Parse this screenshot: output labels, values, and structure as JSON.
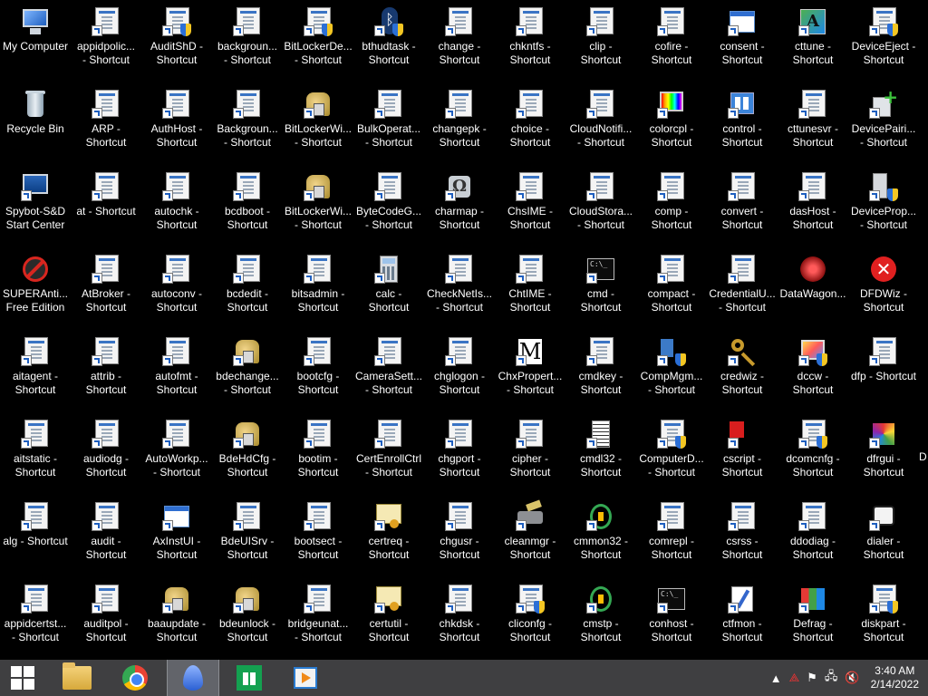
{
  "desktop": {
    "icons": [
      {
        "label": "My Computer",
        "icon": "my-computer-icon",
        "type": "computer"
      },
      {
        "label": "Recycle Bin",
        "icon": "recycle-bin-icon",
        "type": "bin"
      },
      {
        "label": "Spybot-S&D\nStart Center",
        "icon": "spybot-icon",
        "type": "spybot"
      },
      {
        "label": "SUPERAnti...\nFree Edition",
        "icon": "superantispyware-icon",
        "type": "super"
      },
      {
        "label": "aitagent -\nShortcut",
        "icon": "shortcut-icon",
        "type": "file"
      },
      {
        "label": "aitstatic -\nShortcut",
        "icon": "shortcut-icon",
        "type": "file"
      },
      {
        "label": "alg - Shortcut",
        "icon": "shortcut-icon",
        "type": "file"
      },
      {
        "label": "appidcertst...\n- Shortcut",
        "icon": "shortcut-icon",
        "type": "file"
      },
      {
        "label": "appidpolic...\n- Shortcut",
        "icon": "shortcut-icon",
        "type": "file"
      },
      {
        "label": "ARP -\nShortcut",
        "icon": "shortcut-icon",
        "type": "file"
      },
      {
        "label": "at - Shortcut",
        "icon": "shortcut-icon",
        "type": "file"
      },
      {
        "label": "AtBroker -\nShortcut",
        "icon": "shortcut-icon",
        "type": "file"
      },
      {
        "label": "attrib -\nShortcut",
        "icon": "shortcut-icon",
        "type": "file"
      },
      {
        "label": "audiodg -\nShortcut",
        "icon": "shortcut-icon",
        "type": "file"
      },
      {
        "label": "audit -\nShortcut",
        "icon": "shortcut-icon",
        "type": "file"
      },
      {
        "label": "auditpol -\nShortcut",
        "icon": "shortcut-icon",
        "type": "file"
      },
      {
        "label": "AuditShD -\nShortcut",
        "icon": "shield-shortcut-icon",
        "type": "shield"
      },
      {
        "label": "AuthHost -\nShortcut",
        "icon": "shortcut-icon",
        "type": "file"
      },
      {
        "label": "autochk -\nShortcut",
        "icon": "shortcut-icon",
        "type": "file"
      },
      {
        "label": "autoconv -\nShortcut",
        "icon": "shortcut-icon",
        "type": "file"
      },
      {
        "label": "autofmt -\nShortcut",
        "icon": "shortcut-icon",
        "type": "file"
      },
      {
        "label": "AutoWorkp...\n- Shortcut",
        "icon": "shortcut-icon",
        "type": "file"
      },
      {
        "label": "AxInstUI -\nShortcut",
        "icon": "window-shortcut-icon",
        "type": "window"
      },
      {
        "label": "baaupdate -\nShortcut",
        "icon": "keys-shortcut-icon",
        "type": "keys"
      },
      {
        "label": "backgroun...\n- Shortcut",
        "icon": "shortcut-icon",
        "type": "file"
      },
      {
        "label": "Backgroun...\n- Shortcut",
        "icon": "shortcut-icon",
        "type": "file"
      },
      {
        "label": "bcdboot -\nShortcut",
        "icon": "shortcut-icon",
        "type": "file"
      },
      {
        "label": "bcdedit -\nShortcut",
        "icon": "shortcut-icon",
        "type": "file"
      },
      {
        "label": "bdechange...\n- Shortcut",
        "icon": "keys-shortcut-icon",
        "type": "keys"
      },
      {
        "label": "BdeHdCfg -\nShortcut",
        "icon": "keys-shortcut-icon",
        "type": "keys"
      },
      {
        "label": "BdeUISrv -\nShortcut",
        "icon": "shortcut-icon",
        "type": "file"
      },
      {
        "label": "bdeunlock -\nShortcut",
        "icon": "keys-shortcut-icon",
        "type": "keys"
      },
      {
        "label": "BitLockerDe...\n- Shortcut",
        "icon": "shield-shortcut-icon",
        "type": "shield"
      },
      {
        "label": "BitLockerWi...\n- Shortcut",
        "icon": "keys-shortcut-icon",
        "type": "keys"
      },
      {
        "label": "BitLockerWi...\n- Shortcut",
        "icon": "keys-shortcut-icon",
        "type": "keys"
      },
      {
        "label": "bitsadmin -\nShortcut",
        "icon": "shortcut-icon",
        "type": "file"
      },
      {
        "label": "bootcfg -\nShortcut",
        "icon": "shortcut-icon",
        "type": "file"
      },
      {
        "label": "bootim -\nShortcut",
        "icon": "shortcut-icon",
        "type": "file"
      },
      {
        "label": "bootsect -\nShortcut",
        "icon": "shortcut-icon",
        "type": "file"
      },
      {
        "label": "bridgeunat...\n- Shortcut",
        "icon": "shortcut-icon",
        "type": "file"
      },
      {
        "label": "bthudtask -\nShortcut",
        "icon": "bluetooth-shortcut-icon",
        "type": "bt"
      },
      {
        "label": "BulkOperat...\n- Shortcut",
        "icon": "shortcut-icon",
        "type": "file"
      },
      {
        "label": "ByteCodeG...\n- Shortcut",
        "icon": "shortcut-icon",
        "type": "file"
      },
      {
        "label": "calc -\nShortcut",
        "icon": "calculator-shortcut-icon",
        "type": "calc"
      },
      {
        "label": "CameraSett...\n- Shortcut",
        "icon": "shortcut-icon",
        "type": "file"
      },
      {
        "label": "CertEnrollCtrl\n- Shortcut",
        "icon": "shortcut-icon",
        "type": "file"
      },
      {
        "label": "certreq -\nShortcut",
        "icon": "certificate-shortcut-icon",
        "type": "cert"
      },
      {
        "label": "certutil -\nShortcut",
        "icon": "certificate-shortcut-icon",
        "type": "cert"
      },
      {
        "label": "change -\nShortcut",
        "icon": "shortcut-icon",
        "type": "file"
      },
      {
        "label": "changepk -\nShortcut",
        "icon": "shortcut-icon",
        "type": "file"
      },
      {
        "label": "charmap -\nShortcut",
        "icon": "charmap-shortcut-icon",
        "type": "charmap"
      },
      {
        "label": "CheckNetIs...\n- Shortcut",
        "icon": "shortcut-icon",
        "type": "file"
      },
      {
        "label": "chglogon -\nShortcut",
        "icon": "shortcut-icon",
        "type": "file"
      },
      {
        "label": "chgport -\nShortcut",
        "icon": "shortcut-icon",
        "type": "file"
      },
      {
        "label": "chgusr -\nShortcut",
        "icon": "shortcut-icon",
        "type": "file"
      },
      {
        "label": "chkdsk -\nShortcut",
        "icon": "shortcut-icon",
        "type": "file"
      },
      {
        "label": "chkntfs -\nShortcut",
        "icon": "shortcut-icon",
        "type": "file"
      },
      {
        "label": "choice -\nShortcut",
        "icon": "shortcut-icon",
        "type": "file"
      },
      {
        "label": "ChsIME -\nShortcut",
        "icon": "shortcut-icon",
        "type": "file"
      },
      {
        "label": "ChtIME -\nShortcut",
        "icon": "shortcut-icon",
        "type": "file"
      },
      {
        "label": "ChxPropert...\n- Shortcut",
        "icon": "chx-shortcut-icon",
        "type": "chx"
      },
      {
        "label": "cipher -\nShortcut",
        "icon": "shortcut-icon",
        "type": "file"
      },
      {
        "label": "cleanmgr -\nShortcut",
        "icon": "cleanmgr-shortcut-icon",
        "type": "cleanmgr"
      },
      {
        "label": "cliconfg -\nShortcut",
        "icon": "shield-shortcut-icon",
        "type": "shield"
      },
      {
        "label": "clip -\nShortcut",
        "icon": "shortcut-icon",
        "type": "file"
      },
      {
        "label": "CloudNotifi...\n- Shortcut",
        "icon": "shortcut-icon",
        "type": "file"
      },
      {
        "label": "CloudStora...\n- Shortcut",
        "icon": "shortcut-icon",
        "type": "file"
      },
      {
        "label": "cmd -\nShortcut",
        "icon": "cmd-shortcut-icon",
        "type": "cmd"
      },
      {
        "label": "cmdkey -\nShortcut",
        "icon": "shortcut-icon",
        "type": "file"
      },
      {
        "label": "cmdl32 -\nShortcut",
        "icon": "cmdl32-shortcut-icon",
        "type": "cmdl"
      },
      {
        "label": "cmmon32 -\nShortcut",
        "icon": "cmmon32-shortcut-icon",
        "type": "cmmon"
      },
      {
        "label": "cmstp -\nShortcut",
        "icon": "cmstp-shortcut-icon",
        "type": "cmmon"
      },
      {
        "label": "cofire -\nShortcut",
        "icon": "shortcut-icon",
        "type": "file"
      },
      {
        "label": "colorcpl -\nShortcut",
        "icon": "colorcpl-shortcut-icon",
        "type": "colorcpl"
      },
      {
        "label": "comp -\nShortcut",
        "icon": "shortcut-icon",
        "type": "file"
      },
      {
        "label": "compact -\nShortcut",
        "icon": "shortcut-icon",
        "type": "file"
      },
      {
        "label": "CompMgm...\n- Shortcut",
        "icon": "compmgmt-shortcut-icon",
        "type": "compmgmt"
      },
      {
        "label": "ComputerD...\n- Shortcut",
        "icon": "shield-shortcut-icon",
        "type": "shield"
      },
      {
        "label": "comrepl -\nShortcut",
        "icon": "shortcut-icon",
        "type": "file"
      },
      {
        "label": "conhost -\nShortcut",
        "icon": "cmd-shortcut-icon",
        "type": "cmd"
      },
      {
        "label": "consent -\nShortcut",
        "icon": "window-shortcut-icon",
        "type": "window"
      },
      {
        "label": "control -\nShortcut",
        "icon": "control-panel-shortcut-icon",
        "type": "control"
      },
      {
        "label": "convert -\nShortcut",
        "icon": "shortcut-icon",
        "type": "file"
      },
      {
        "label": "CredentialU...\n- Shortcut",
        "icon": "shortcut-icon",
        "type": "file"
      },
      {
        "label": "credwiz -\nShortcut",
        "icon": "key-shortcut-icon",
        "type": "credwiz"
      },
      {
        "label": "cscript -\nShortcut",
        "icon": "cscript-shortcut-icon",
        "type": "cscript"
      },
      {
        "label": "csrss -\nShortcut",
        "icon": "shortcut-icon",
        "type": "file"
      },
      {
        "label": "ctfmon -\nShortcut",
        "icon": "ctfmon-shortcut-icon",
        "type": "ctfmon"
      },
      {
        "label": "cttune -\nShortcut",
        "icon": "cttune-shortcut-icon",
        "type": "cttune"
      },
      {
        "label": "cttunesvr -\nShortcut",
        "icon": "shortcut-icon",
        "type": "file"
      },
      {
        "label": "dasHost -\nShortcut",
        "icon": "shortcut-icon",
        "type": "file"
      },
      {
        "label": "DataWagon...",
        "icon": "datawagon-icon",
        "type": "datawagon"
      },
      {
        "label": "dccw -\nShortcut",
        "icon": "dccw-shortcut-icon",
        "type": "dccw"
      },
      {
        "label": "dcomcnfg -\nShortcut",
        "icon": "shield-shortcut-icon",
        "type": "shield"
      },
      {
        "label": "ddodiag -\nShortcut",
        "icon": "shortcut-icon",
        "type": "file"
      },
      {
        "label": "Defrag -\nShortcut",
        "icon": "defrag-shortcut-icon",
        "type": "defrag"
      },
      {
        "label": "DeviceEject -\nShortcut",
        "icon": "device-eject-shortcut-icon",
        "type": "shield"
      },
      {
        "label": "DevicePairi...\n- Shortcut",
        "icon": "device-pairing-shortcut-icon",
        "type": "devpair"
      },
      {
        "label": "DeviceProp...\n- Shortcut",
        "icon": "device-properties-shortcut-icon",
        "type": "devprop"
      },
      {
        "label": "DFDWiz -\nShortcut",
        "icon": "dfdwiz-shortcut-icon",
        "type": "dfdwiz"
      },
      {
        "label": "dfp - Shortcut",
        "icon": "shortcut-icon",
        "type": "file"
      },
      {
        "label": "dfrgui -\nShortcut",
        "icon": "dfrgui-shortcut-icon",
        "type": "dfrgui"
      },
      {
        "label": "dialer -\nShortcut",
        "icon": "dialer-shortcut-icon",
        "type": "dialer"
      },
      {
        "label": "diskpart -\nShortcut",
        "icon": "shield-shortcut-icon",
        "type": "shield"
      }
    ],
    "edge_text": "D"
  },
  "taskbar": {
    "start_icon": "windows-start-icon",
    "pinned": [
      {
        "icon": "file-explorer-icon",
        "active": false
      },
      {
        "icon": "chrome-icon",
        "active": false
      },
      {
        "icon": "flame-app-icon",
        "active": true
      },
      {
        "icon": "store-icon",
        "active": false
      },
      {
        "icon": "media-player-icon",
        "active": false
      }
    ],
    "tray": {
      "time": "3:40 AM",
      "date": "2/14/2022"
    }
  }
}
